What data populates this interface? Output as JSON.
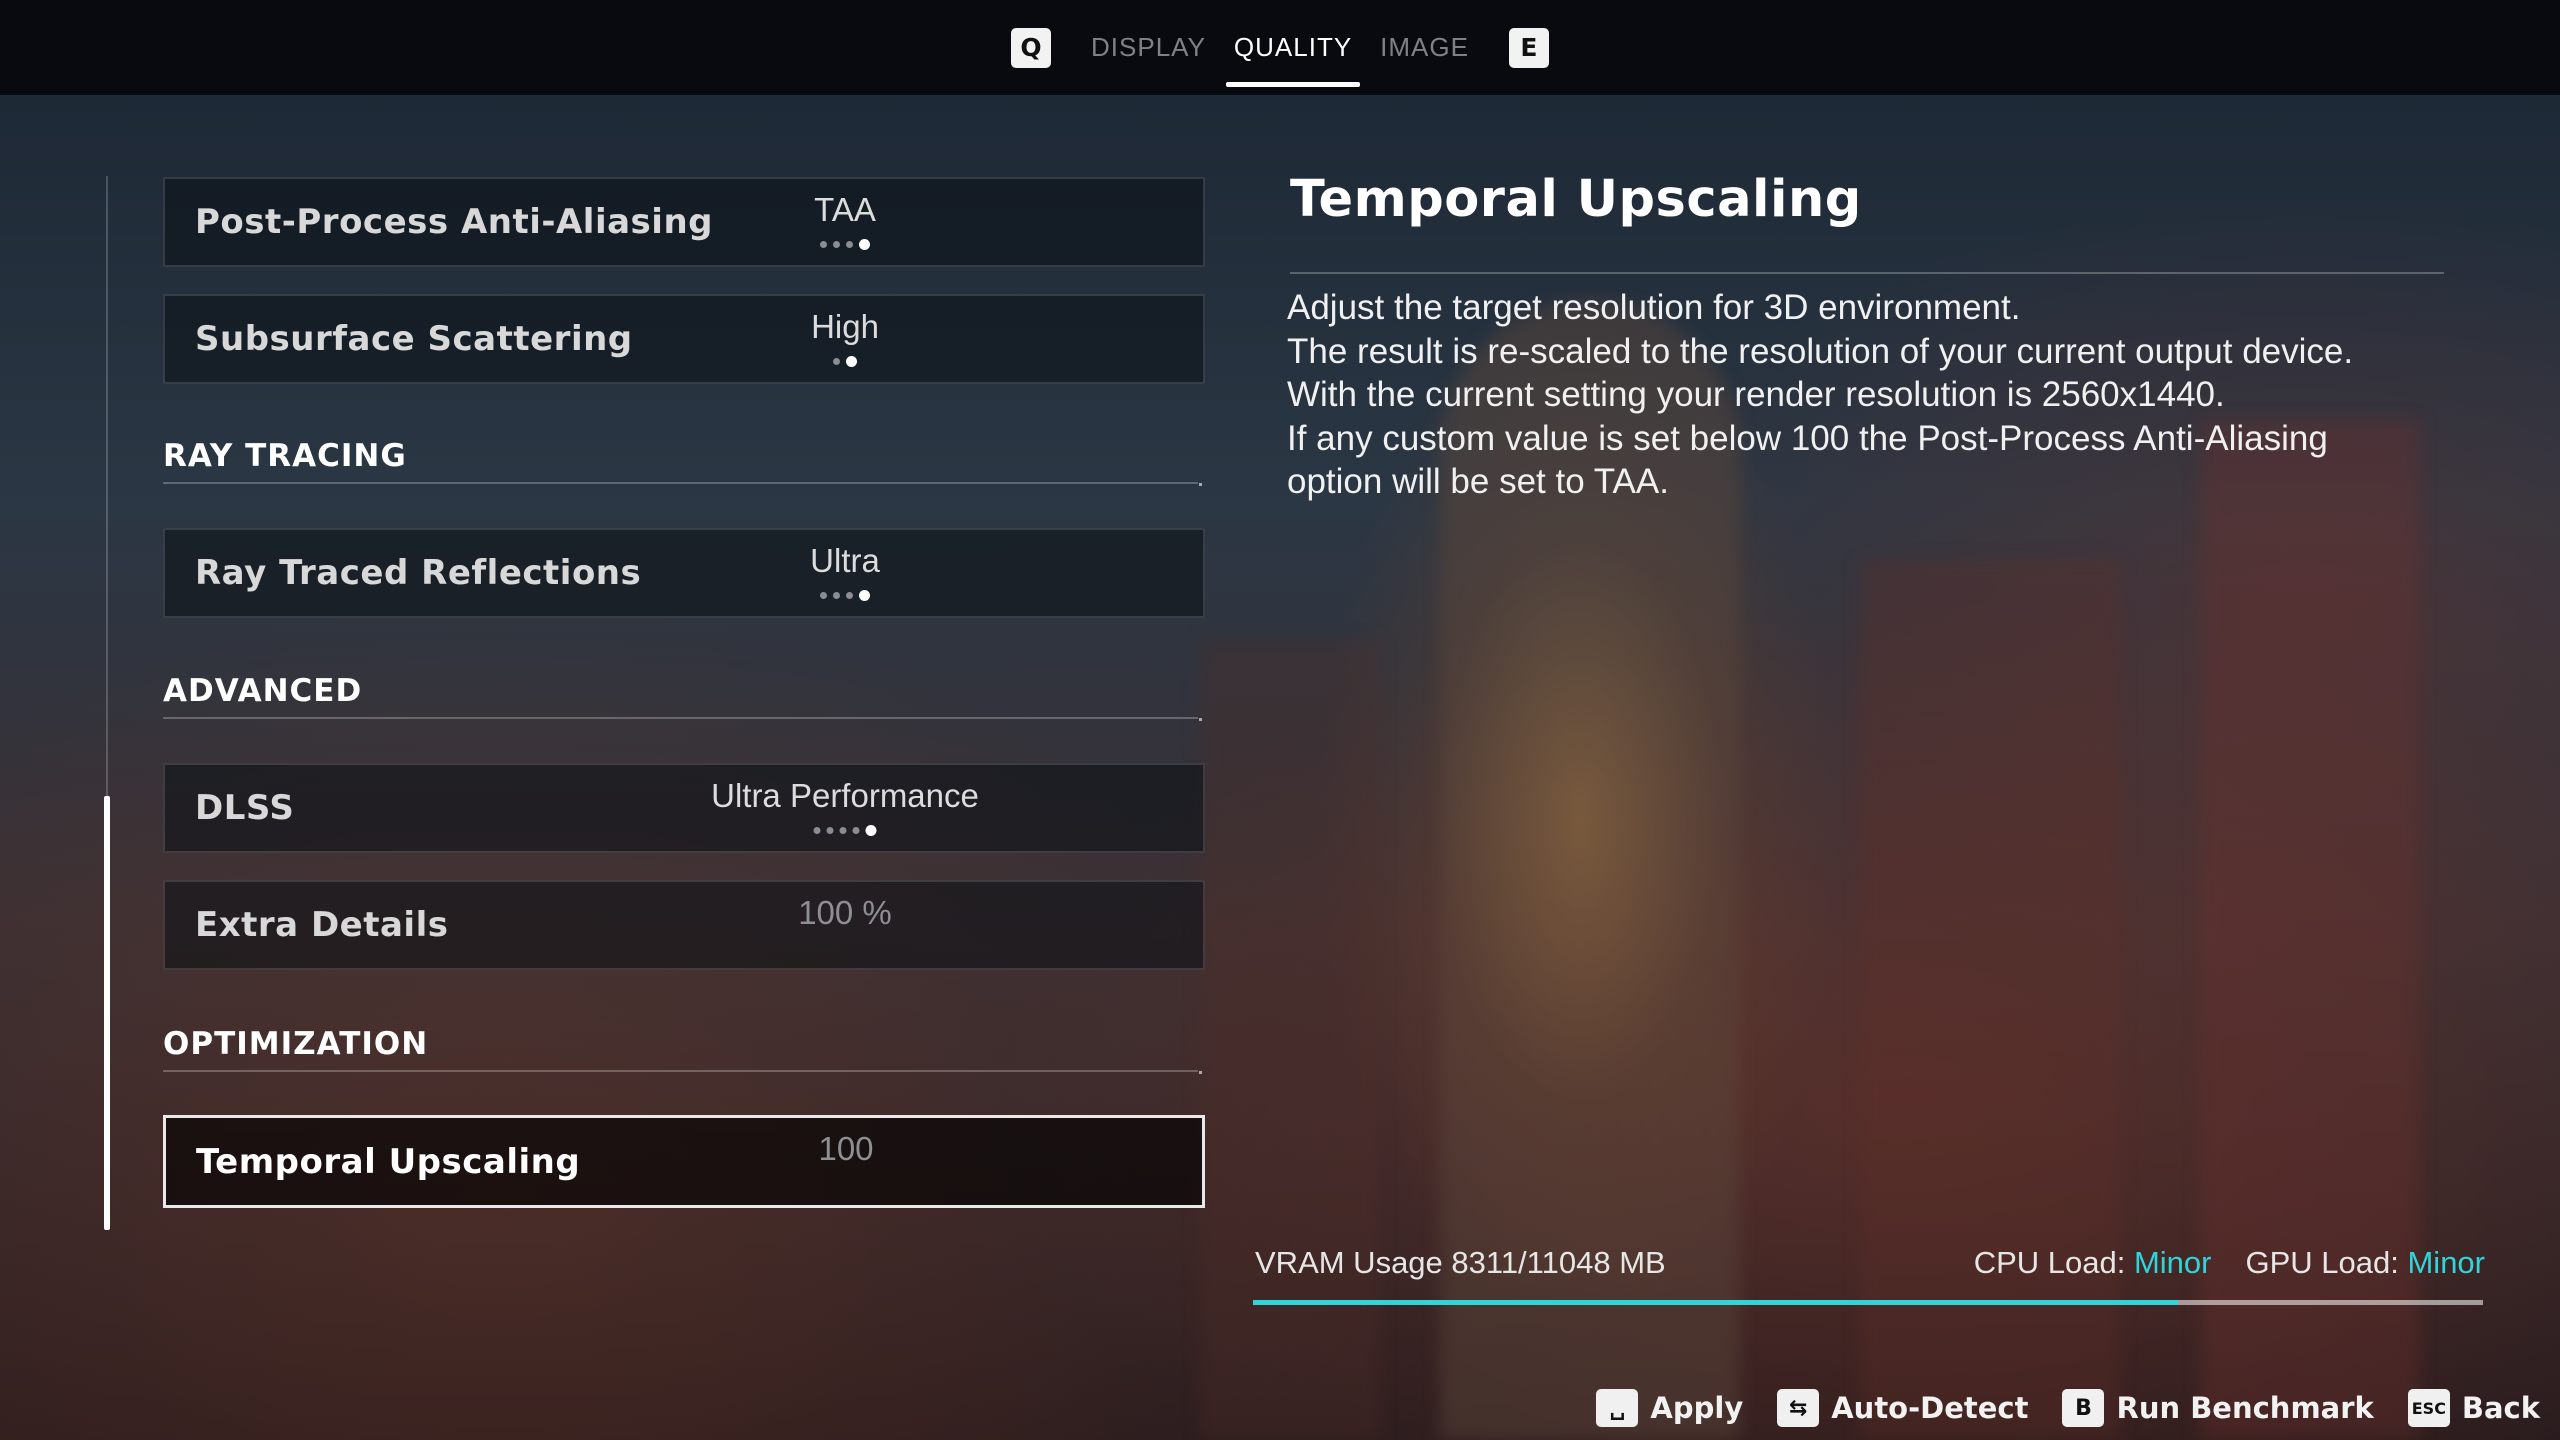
{
  "topbar": {
    "prev_key": "Q",
    "next_key": "E",
    "tabs": [
      {
        "label": "DISPLAY",
        "active": false
      },
      {
        "label": "QUALITY",
        "active": true
      },
      {
        "label": "IMAGE",
        "active": false
      }
    ]
  },
  "settings": {
    "post_process_aa": {
      "label": "Post-Process Anti-Aliasing",
      "value": "TAA",
      "level": 4,
      "levels": 4
    },
    "subsurface_scattering": {
      "label": "Subsurface Scattering",
      "value": "High",
      "level": 2,
      "levels": 2
    },
    "ray_tracing_section": "RAY TRACING",
    "ray_traced_reflections": {
      "label": "Ray Traced Reflections",
      "value": "Ultra",
      "level": 4,
      "levels": 4
    },
    "advanced_section": "ADVANCED",
    "dlss": {
      "label": "DLSS",
      "value": "Ultra Performance",
      "level": 5,
      "levels": 5
    },
    "extra_details": {
      "label": "Extra Details",
      "value": "100 %"
    },
    "optimization_section": "OPTIMIZATION",
    "temporal_upscaling": {
      "label": "Temporal Upscaling",
      "value": "100"
    }
  },
  "description": {
    "title": "Temporal Upscaling",
    "lines": [
      "Adjust the target resolution for 3D environment.",
      "The result is re-scaled to the resolution of your current output device.",
      "With the current setting your render resolution is 2560x1440.",
      "If any custom value is set below 100 the Post-Process Anti-Aliasing",
      "option will be set to TAA."
    ]
  },
  "stats": {
    "vram_label": "VRAM Usage 8311/11048 MB",
    "vram_used_mb": 8311,
    "vram_total_mb": 11048,
    "cpu_label": "CPU Load:",
    "cpu_value": "Minor",
    "gpu_label": "GPU Load:",
    "gpu_value": "Minor",
    "accent_color": "#2fd5d9"
  },
  "actions": [
    {
      "key": "␣",
      "icon": "space-key-icon",
      "label": "Apply"
    },
    {
      "key": "⇆",
      "icon": "tab-key-icon",
      "label": "Auto-Detect"
    },
    {
      "key": "B",
      "icon": "b-key-icon",
      "label": "Run Benchmark"
    },
    {
      "key": "ESC",
      "icon": "esc-key-icon",
      "label": "Back"
    }
  ]
}
